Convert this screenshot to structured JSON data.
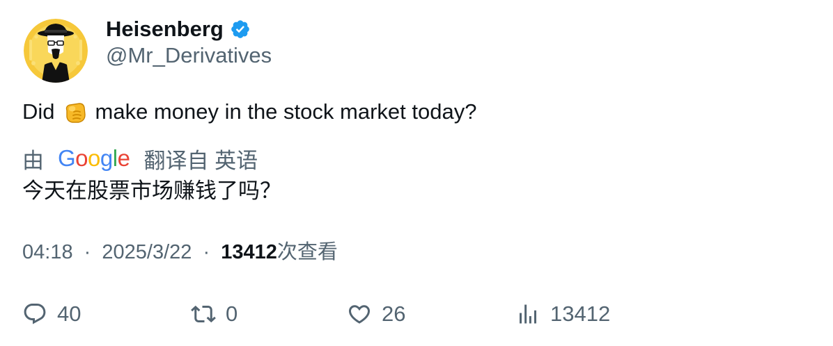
{
  "author": {
    "display_name": "Heisenberg",
    "handle": "@Mr_Derivatives",
    "verified": true
  },
  "tweet": {
    "text_before_emoji": "Did",
    "emoji": "pointing-fist-emoji",
    "text_after_emoji": "make money in the stock market today?"
  },
  "translation": {
    "by_label": "由",
    "provider": "Google",
    "from_label": "翻译自 英语",
    "text": "今天在股票市场赚钱了吗？"
  },
  "meta": {
    "time": "04:18",
    "separator": "·",
    "date": "2025/3/22",
    "views_count": "13412",
    "views_label": "次查看"
  },
  "actions": {
    "replies": "40",
    "retweets": "0",
    "likes": "26",
    "views": "13412"
  },
  "colors": {
    "verified_badge": "#1d9bf0",
    "secondary_text": "#536471",
    "primary_text": "#0f1419",
    "avatar_bg": "#f6c83a"
  }
}
